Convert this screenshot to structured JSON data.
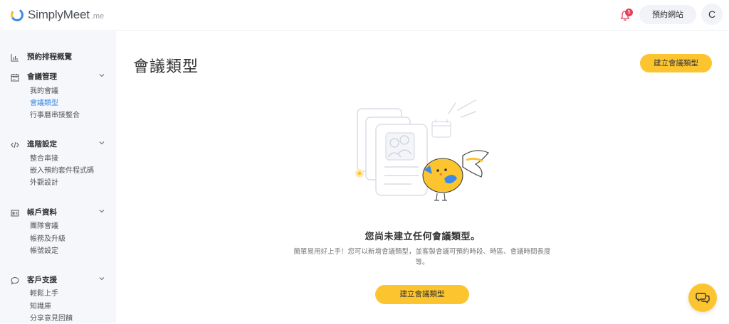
{
  "header": {
    "logo_text": "SimplyMeet",
    "logo_suffix": ".me",
    "notification_count": "5",
    "booking_site_label": "預約網站",
    "avatar_initial": "C"
  },
  "sidebar": {
    "sections": [
      {
        "title": "預約排程概覽",
        "icon": "bar-chart-icon",
        "items": []
      },
      {
        "title": "會議管理",
        "icon": "calendar-icon",
        "items": [
          "我的會議",
          "會議類型",
          "行事曆串接整合"
        ]
      },
      {
        "title": "進階設定",
        "icon": "code-icon",
        "items": [
          "整合串接",
          "嵌入預約套件程式碼",
          "外觀設計"
        ]
      },
      {
        "title": "帳戶資料",
        "icon": "id-card-icon",
        "items": [
          "團隊會議",
          "帳務及升級",
          "帳號設定"
        ]
      },
      {
        "title": "客戶支援",
        "icon": "chat-bubble-icon",
        "items": [
          "輕鬆上手",
          "知識庫",
          "分享意見回饋"
        ]
      }
    ],
    "active_item": "會議類型"
  },
  "main": {
    "title": "會議類型",
    "create_button_label": "建立會議類型",
    "empty_title": "您尚未建立任何會議類型。",
    "empty_description": "簡單易用好上手！您可以新增會議類型，並客製會議可預約時段、時區、會議時間長度等。",
    "empty_button_label": "建立會議類型"
  },
  "colors": {
    "accent_yellow": "#fcc52f",
    "active_link": "#3d8ae6",
    "sidebar_bg": "#f5f7fb",
    "badge_red": "#e8415e"
  }
}
